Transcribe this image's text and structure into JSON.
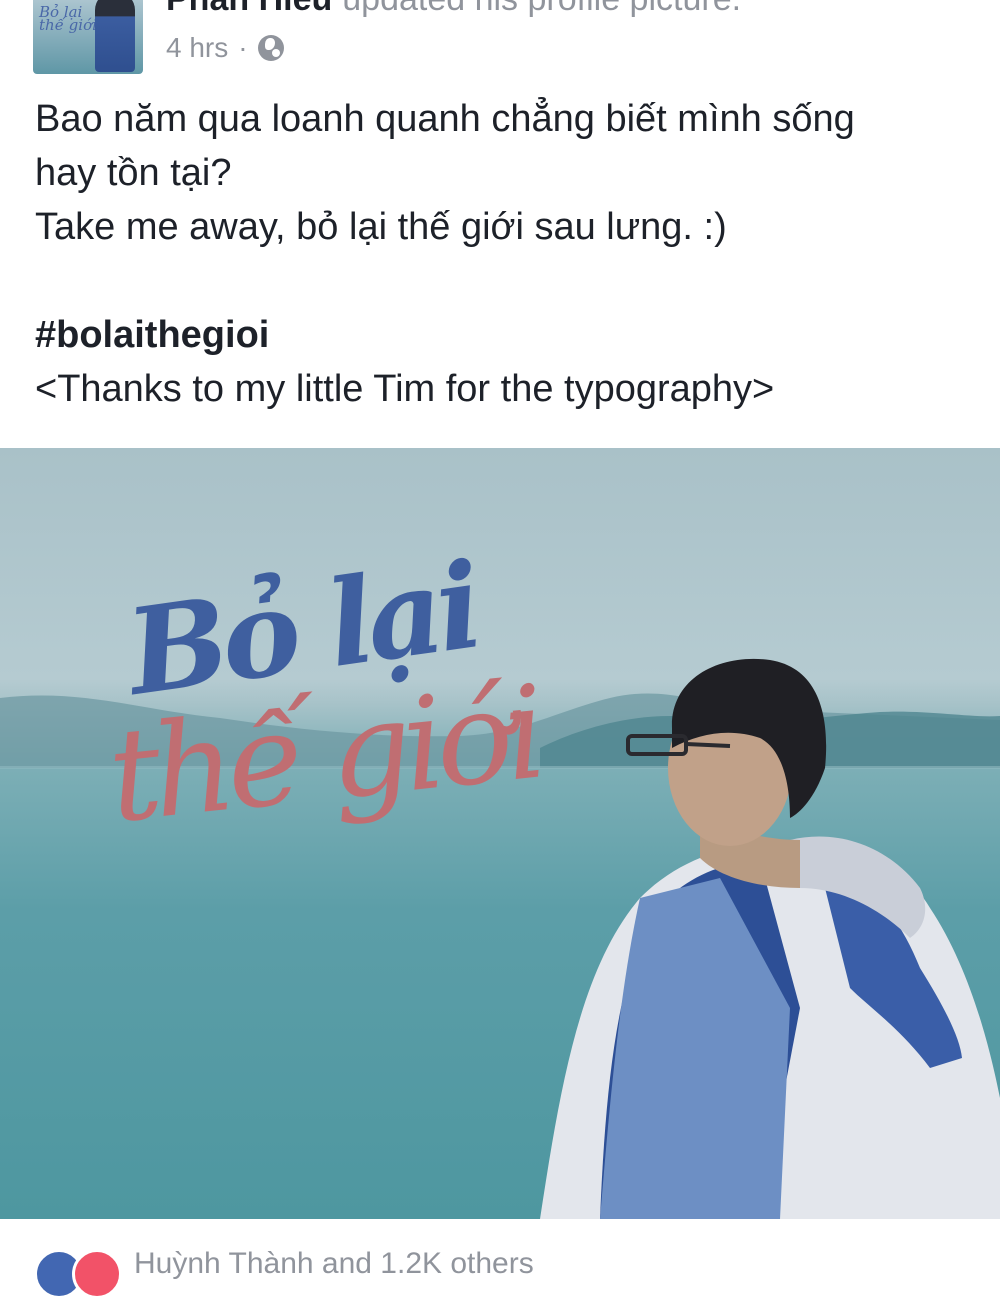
{
  "post": {
    "author": "Phan Hiếu",
    "action": "updated his profile picture.",
    "timestamp": "4 hrs",
    "separator": "·",
    "privacy_icon": "globe-icon",
    "avatar_text": "Bỏ lại thế giới",
    "lines": [
      "Bao năm qua loanh quanh chẳng biết mình sống",
      "hay tồn tại?",
      "Take me away, bỏ lại thế giới sau lưng. :)"
    ],
    "hashtag": "#bolaithegioi",
    "credit": "<Thanks to my little Tim for the typography>"
  },
  "photo": {
    "title_line1": "Bỏ lại",
    "title_line2": "thế giới",
    "title_colors": {
      "line1": "#3f5f9f",
      "line2": "#c06e72"
    }
  },
  "reactions": {
    "icons": [
      "like-icon",
      "love-icon"
    ],
    "summary": "Huỳnh Thành and 1.2K others"
  }
}
